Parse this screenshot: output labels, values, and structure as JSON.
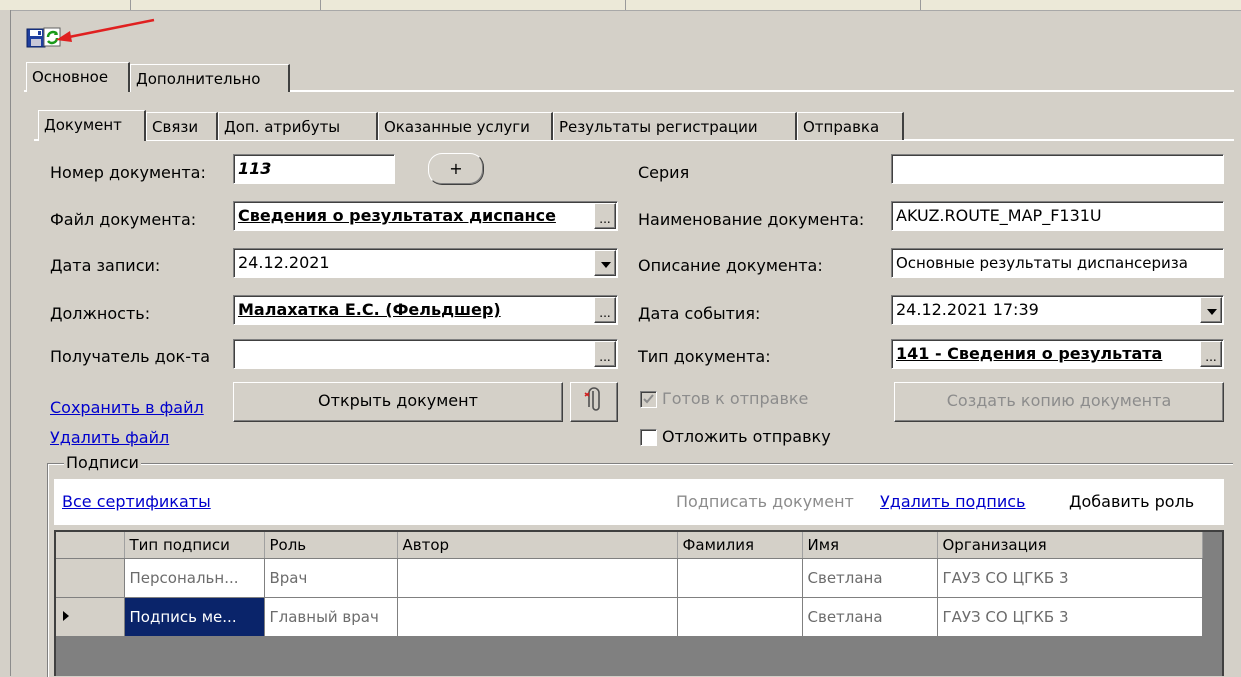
{
  "tabs_main": [
    "Основное",
    "Дополнительно"
  ],
  "tabs_sub": [
    "Документ",
    "Связи",
    "Доп. атрибуты",
    "Оказанные услуги",
    "Результаты регистрации",
    "Отправка"
  ],
  "left_form": {
    "doc_number_label": "Номер документа:",
    "doc_number_value": "113",
    "plus_label": "+",
    "doc_file_label": "Файл документа:",
    "doc_file_value": "Сведения о результатах диспансе",
    "record_date_label": "Дата записи:",
    "record_date_value": "24.12.2021",
    "position_label": "Должность:",
    "position_value": "Малахатка Е.С. (Фельдшер)",
    "recipient_label": "Получатель док-та",
    "recipient_value": "",
    "dots": "..."
  },
  "right_form": {
    "series_label": "Серия",
    "series_value": "",
    "doc_name_label": "Наименование документа:",
    "doc_name_value": "AKUZ.ROUTE_MAP_F131U",
    "doc_desc_label": "Описание документа:",
    "doc_desc_value": "Основные результаты диспансериза",
    "event_date_label": "Дата события:",
    "event_date_value": "24.12.2021 17:39",
    "doc_type_label": "Тип документа:",
    "doc_type_value": "141 - Сведения о результата"
  },
  "actions": {
    "save_to_file": "Сохранить в файл",
    "delete_file": "Удалить файл",
    "open_document": "Открыть документ",
    "ready_to_send": "Готов к отправке",
    "postpone_send": "Отложить отправку",
    "create_copy": "Создать копию документа"
  },
  "signatures": {
    "group_label": "Подписи",
    "all_certs": "Все сертификаты",
    "sign_doc": "Подписать документ",
    "delete_sign": "Удалить подпись",
    "add_role": "Добавить роль",
    "columns": [
      "Тип подписи",
      "Роль",
      "Автор",
      "Фамилия",
      "Имя",
      "Организация"
    ],
    "rows": [
      {
        "type": "Персональн...",
        "role": "Врач",
        "author": "",
        "surname": "",
        "name": "Светлана",
        "org": "ГАУЗ СО ЦГКБ 3"
      },
      {
        "type": "Подпись ме...",
        "role": "Главный врач",
        "author": "",
        "surname": "",
        "name": "Светлана",
        "org": "ГАУЗ СО ЦГКБ 3"
      }
    ]
  },
  "icons": [
    "save-icon",
    "refresh-icon",
    "red-arrow",
    "paperclip-icon"
  ]
}
